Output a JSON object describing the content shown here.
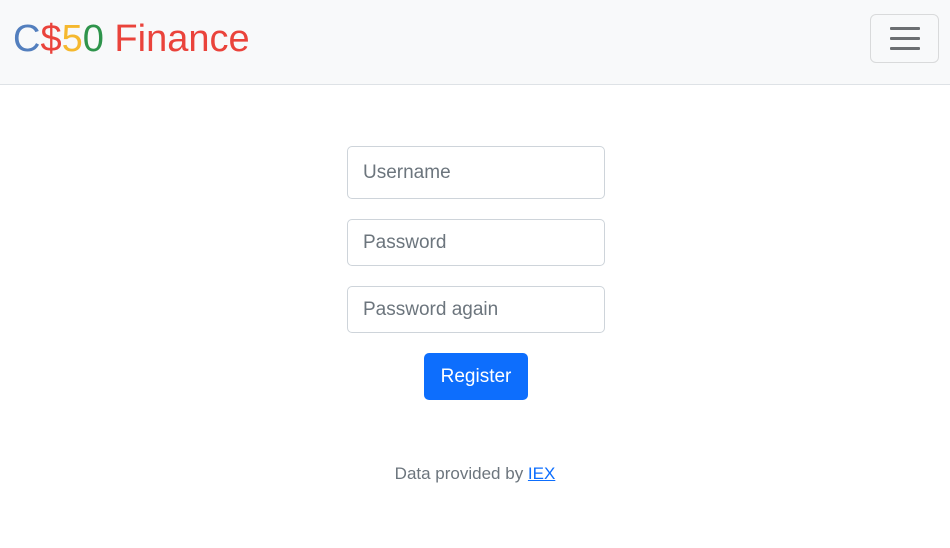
{
  "navbar": {
    "brand": {
      "parts": [
        {
          "text": "C",
          "color": "#537fbe"
        },
        {
          "text": "$",
          "color": "#ea433b"
        },
        {
          "text": "5",
          "color": "#f5b82e"
        },
        {
          "text": "0",
          "color": "#2e944b"
        },
        {
          "text": " Finance",
          "color": "#ea433b"
        }
      ]
    },
    "toggler_icon": "hamburger-menu-icon"
  },
  "form": {
    "username_placeholder": "Username",
    "password_placeholder": "Password",
    "confirmation_placeholder": "Password again",
    "submit_label": "Register"
  },
  "footer": {
    "text": "Data provided by ",
    "link_text": "IEX"
  },
  "colors": {
    "primary": "#0d6efd",
    "navbar_bg": "#f8f9fa"
  }
}
